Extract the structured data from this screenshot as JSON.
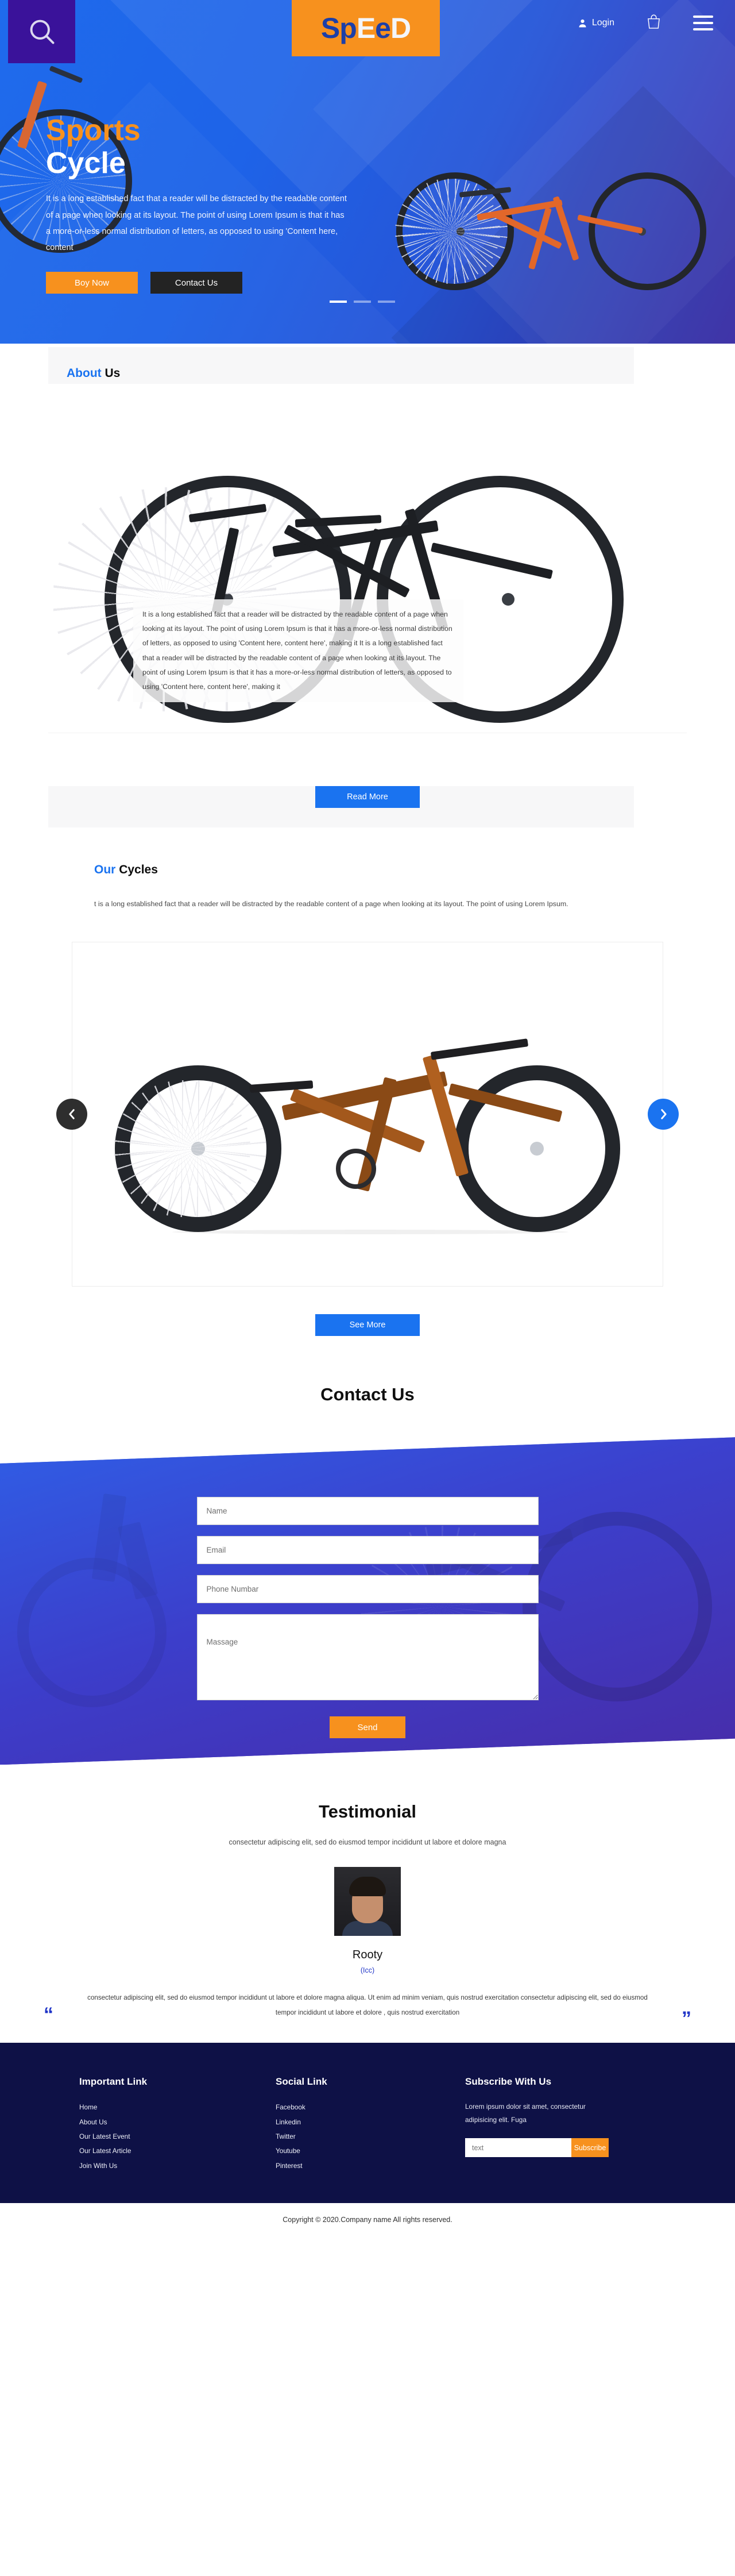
{
  "header": {
    "search_icon": "search-icon",
    "logo": {
      "part1": "Sp",
      "part2": "E",
      "part3": "e",
      "part4": "D",
      "full": "SpEeD"
    },
    "login_label": "Login",
    "cart_icon": "shopping-bag-icon",
    "menu_icon": "hamburger-menu-icon"
  },
  "hero": {
    "title_accent": "Sports",
    "title_main": "Cycle",
    "paragraph": "It is a long established fact that a reader will be distracted by the readable content of a page when looking at its layout. The point of using Lorem Ipsum is that it has a more-or-less normal distribution of letters, as opposed to using 'Content here, content",
    "buy_label": "Boy Now",
    "contact_label": "Contact Us",
    "slides": [
      {
        "active": true
      },
      {
        "active": false
      },
      {
        "active": false
      }
    ]
  },
  "about": {
    "heading_accent": "About",
    "heading_dark": "Us",
    "paragraph": "It is a long established fact that a reader will be distracted by the readable content of a page when looking at its layout. The point of using Lorem Ipsum is that it has a more-or-less normal distribution of letters, as opposed to using 'Content here, content here', making it It is a long established fact that a reader will be distracted by the readable content of a page when looking at its layout. The point of using Lorem Ipsum is that it has a more-or-less normal distribution of letters, as opposed to using 'Content here, content here', making it",
    "read_more_label": "Read More"
  },
  "cycles": {
    "heading_accent": "Our",
    "heading_dark": "Cycles",
    "paragraph": "t is a long established fact that a reader will be distracted by the readable content of a page when looking at its layout. The point of using Lorem Ipsum.",
    "prev_icon": "chevron-left-icon",
    "next_icon": "chevron-right-icon",
    "see_more_label": "See More"
  },
  "contact": {
    "title": "Contact Us",
    "fields": {
      "name_placeholder": "Name",
      "email_placeholder": "Email",
      "phone_placeholder": "Phone Numbar",
      "message_placeholder": "Massage"
    },
    "send_label": "Send"
  },
  "testimonial": {
    "title": "Testimonial",
    "subtitle": "consectetur adipiscing elit, sed do eiusmod tempor incididunt ut labore et dolore magna",
    "name": "Rooty",
    "role": "(Icc)",
    "quote_open": "“",
    "quote_close": "”",
    "quote": "consectetur adipiscing elit, sed do eiusmod tempor incididunt ut labore et dolore magna aliqua. Ut enim ad minim veniam, quis nostrud exercitation consectetur adipiscing elit, sed do eiusmod tempor incididunt ut labore et dolore , quis nostrud exercitation"
  },
  "footer": {
    "important": {
      "title": "Important Link",
      "items": [
        "Home",
        "About Us",
        "Our Latest Event",
        "Our Latest Article",
        "Join With Us"
      ]
    },
    "social": {
      "title": "Social Link",
      "items": [
        "Facebook",
        "Linkedin",
        "Twitter",
        "Youtube",
        "Pinterest"
      ]
    },
    "subscribe": {
      "title": "Subscribe With Us",
      "description": "Lorem ipsum dolor sit amet, consectetur adipisicing elit. Fuga",
      "input_placeholder": "text",
      "button_label": "Subscribe"
    },
    "copyright": "Copyright © 2020.Company name All rights reserved."
  },
  "colors": {
    "brand_blue": "#1a73f0",
    "brand_orange": "#f7911e",
    "deep_purple": "#3a129a",
    "footer_navy": "#0e1146",
    "logo_blue": "#1c3fa8"
  }
}
